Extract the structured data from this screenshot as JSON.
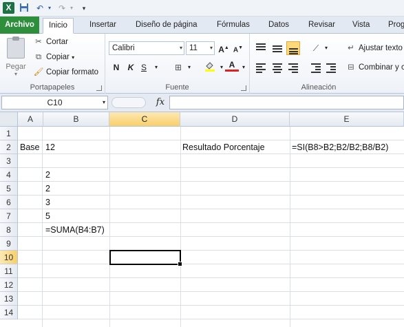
{
  "quick_access": {
    "app_icon_letter": "X",
    "save_icon": "save-icon",
    "undo_icon": "undo-icon",
    "redo_icon": "redo-icon",
    "customize_icon": "customize-qat-icon"
  },
  "tabs": [
    {
      "label": "Archivo"
    },
    {
      "label": "Inicio"
    },
    {
      "label": "Insertar"
    },
    {
      "label": "Diseño de página"
    },
    {
      "label": "Fórmulas"
    },
    {
      "label": "Datos"
    },
    {
      "label": "Revisar"
    },
    {
      "label": "Vista"
    },
    {
      "label": "Prog"
    }
  ],
  "ribbon": {
    "clipboard": {
      "paste_label": "Pegar",
      "cut_label": "Cortar",
      "copy_label": "Copiar",
      "format_painter_label": "Copiar formato",
      "group_label": "Portapapeles"
    },
    "font": {
      "font_name": "Calibri",
      "font_size": "11",
      "bold": "N",
      "italic": "K",
      "underline": "S",
      "group_label": "Fuente"
    },
    "alignment": {
      "wrap_text_label": "Ajustar texto",
      "merge_label": "Combinar y c",
      "group_label": "Alineación"
    }
  },
  "formula_bar": {
    "name_box": "C10",
    "fx_label": "fx",
    "formula": ""
  },
  "sheet": {
    "columns": [
      "A",
      "B",
      "C",
      "D",
      "E"
    ],
    "selected_column": "C",
    "rows": [
      "1",
      "2",
      "3",
      "4",
      "5",
      "6",
      "7",
      "8",
      "9",
      "10",
      "11",
      "12",
      "13",
      "14"
    ],
    "selected_row": "10",
    "cells": {
      "A2": "Base",
      "B2": "12",
      "D2": "Resultado Porcentaje",
      "E2": "=SI(B8>B2;B2/B2;B8/B2)",
      "B4": "2",
      "B5": "2",
      "B6": "3",
      "B7": "5",
      "B8": "=SUMA(B4:B7)"
    },
    "active_cell": "C10"
  },
  "colors": {
    "file_tab": "#2d8f3c",
    "selection_header": "#f8cf6a",
    "grid_line": "#dadfe6"
  }
}
